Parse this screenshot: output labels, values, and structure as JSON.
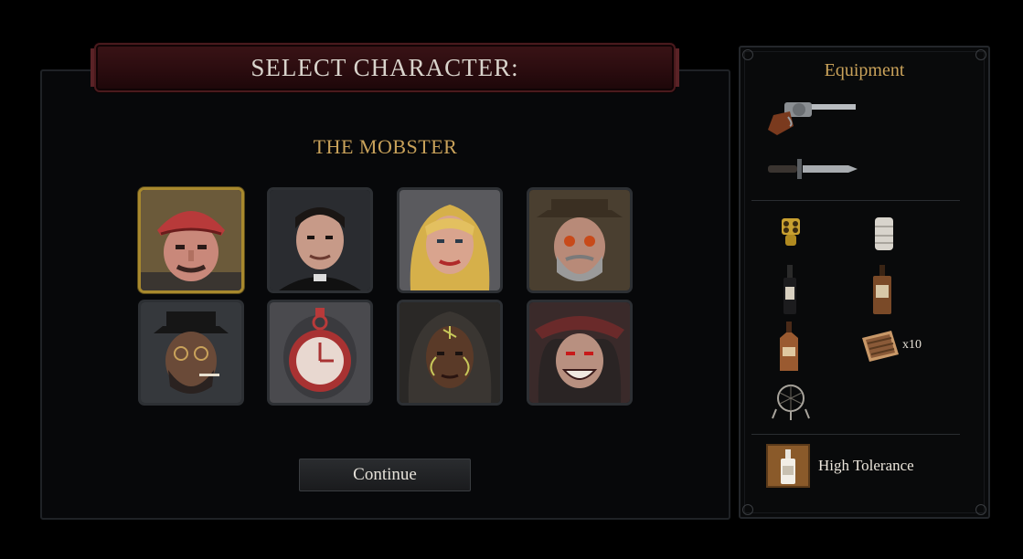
{
  "header": {
    "title": "SELECT CHARACTER:"
  },
  "selected_character": {
    "name": "THE MOBSTER"
  },
  "characters": [
    {
      "id": "mobster",
      "selected": true
    },
    {
      "id": "priest",
      "selected": false
    },
    {
      "id": "blonde-woman",
      "selected": false
    },
    {
      "id": "bearded-man-glasses",
      "selected": false
    },
    {
      "id": "smoking-man-glasses",
      "selected": false
    },
    {
      "id": "locked-stopwatch",
      "selected": false
    },
    {
      "id": "painted-face-woman",
      "selected": false
    },
    {
      "id": "grinning-red-eyes",
      "selected": false
    }
  ],
  "actions": {
    "continue_label": "Continue"
  },
  "equipment": {
    "title": "Equipment",
    "weapons": [
      {
        "icon": "revolver-icon"
      },
      {
        "icon": "knife-icon"
      }
    ],
    "items": [
      {
        "icon": "brass-knuckles-icon"
      },
      {
        "icon": "bandage-icon"
      },
      {
        "icon": "whiskey-bottle-icon"
      },
      {
        "icon": "rum-bottle-icon"
      },
      {
        "icon": "liquor-bottle-icon"
      },
      {
        "icon": "cigar-box-icon",
        "quantity": "x10"
      },
      {
        "icon": "dreamcatcher-icon"
      }
    ],
    "trait": {
      "icon": "bottle-trait-icon",
      "label": "High Tolerance"
    }
  },
  "colors": {
    "gold": "#c9a25a",
    "banner": "#2b0c0f",
    "selected_border": "#a8892e"
  }
}
